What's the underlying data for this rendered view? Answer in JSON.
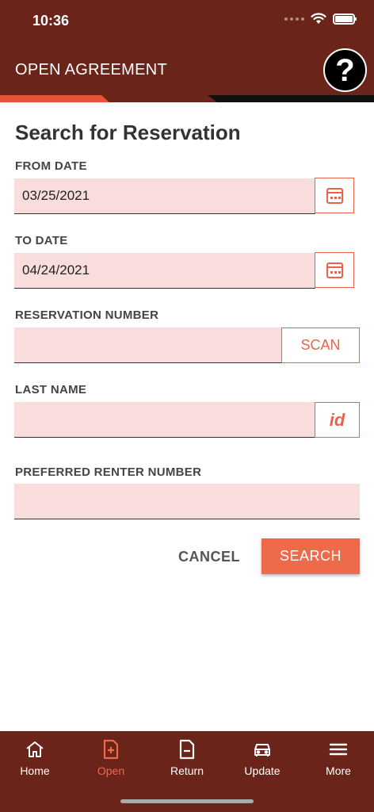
{
  "status": {
    "time": "10:36"
  },
  "header": {
    "title": "OPEN AGREEMENT",
    "help_label": "?"
  },
  "page": {
    "title": "Search for Reservation"
  },
  "fields": {
    "from_date": {
      "label": "FROM DATE",
      "value": "03/25/2021"
    },
    "to_date": {
      "label": "TO DATE",
      "value": "04/24/2021"
    },
    "reservation_number": {
      "label": "RESERVATION NUMBER",
      "value": "",
      "button": "SCAN"
    },
    "last_name": {
      "label": "LAST NAME",
      "value": "",
      "button": "id"
    },
    "preferred_renter": {
      "label": "PREFERRED RENTER NUMBER",
      "value": ""
    }
  },
  "actions": {
    "cancel": "CANCEL",
    "search": "SEARCH"
  },
  "tabs": [
    {
      "label": "Home",
      "icon": "home-icon",
      "active": false
    },
    {
      "label": "Open",
      "icon": "document-plus-icon",
      "active": true
    },
    {
      "label": "Return",
      "icon": "document-minus-icon",
      "active": false
    },
    {
      "label": "Update",
      "icon": "car-icon",
      "active": false
    },
    {
      "label": "More",
      "icon": "menu-icon",
      "active": false
    }
  ],
  "colors": {
    "brand": "#6b2419",
    "accent": "#ee6a4b",
    "input_bg": "#f9dcdc"
  }
}
